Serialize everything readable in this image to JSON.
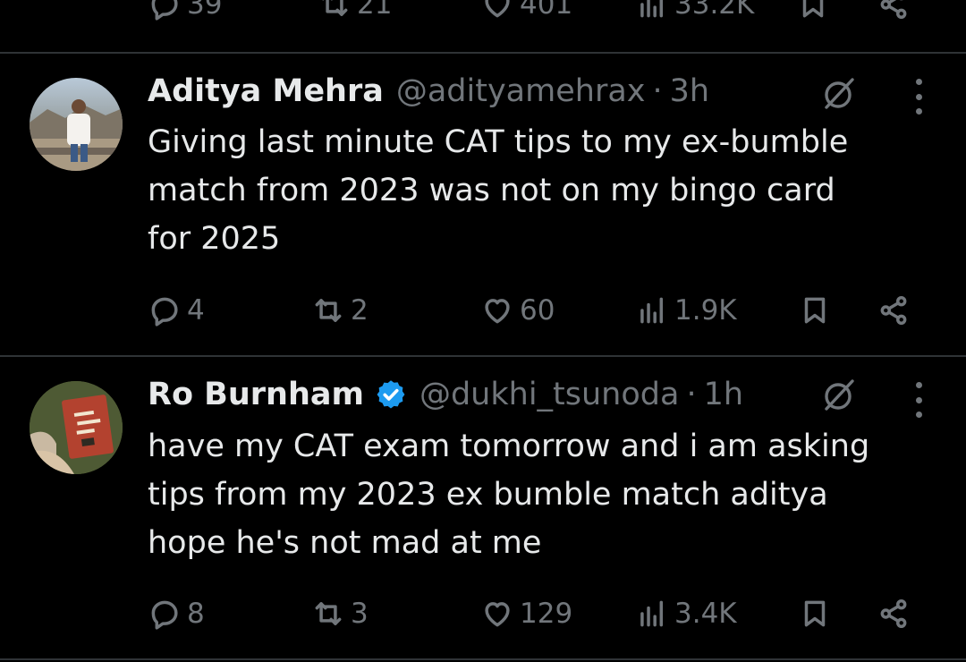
{
  "prev_tweet": {
    "replies": "39",
    "reposts": "21",
    "likes": "401",
    "views": "33.2K"
  },
  "tweets": [
    {
      "name": "Aditya Mehra",
      "handle": "@adityamehrax",
      "separator": "·",
      "time": "3h",
      "verified": false,
      "lines": [
        "Giving last minute CAT tips to my ex-bumble",
        "match from 2023 was not on my bingo card",
        "for 2025"
      ],
      "replies": "4",
      "reposts": "2",
      "likes": "60",
      "views": "1.9K"
    },
    {
      "name": "Ro Burnham",
      "handle": "@dukhi_tsunoda",
      "separator": "·",
      "time": "1h",
      "verified": true,
      "lines": [
        "have my CAT exam tomorrow and i am asking",
        "tips from my 2023 ex bumble match aditya",
        "hope he's not mad at me"
      ],
      "replies": "8",
      "reposts": "3",
      "likes": "129",
      "views": "3.4K"
    }
  ],
  "colors": {
    "background": "#000000",
    "text": "#e7e9ea",
    "muted": "#71767b",
    "divider": "#2f3336",
    "verified": "#1d9bf0"
  },
  "icons": [
    "reply-icon",
    "repost-icon",
    "like-icon",
    "views-icon",
    "bookmark-icon",
    "share-icon",
    "grok-icon",
    "more-icon",
    "verified-badge-icon"
  ]
}
